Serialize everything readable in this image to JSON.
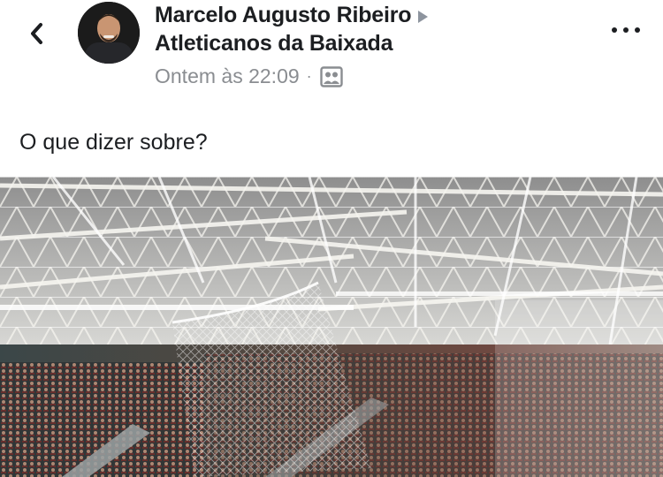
{
  "post": {
    "author": "Marcelo Augusto Ribeiro",
    "group": "Atleticanos da Baixada",
    "timestamp": "Ontem às 22:09",
    "separator": "·",
    "privacy_icon": "group-icon",
    "text": "O que dizer sobre?",
    "photo_icon": "stadium-photo"
  },
  "nav": {
    "back_icon": "chevron-left-icon",
    "more_icon": "more-options-icon"
  },
  "colors": {
    "text": "#1c1e21",
    "secondary": "#8a8d91",
    "background": "#ffffff"
  }
}
